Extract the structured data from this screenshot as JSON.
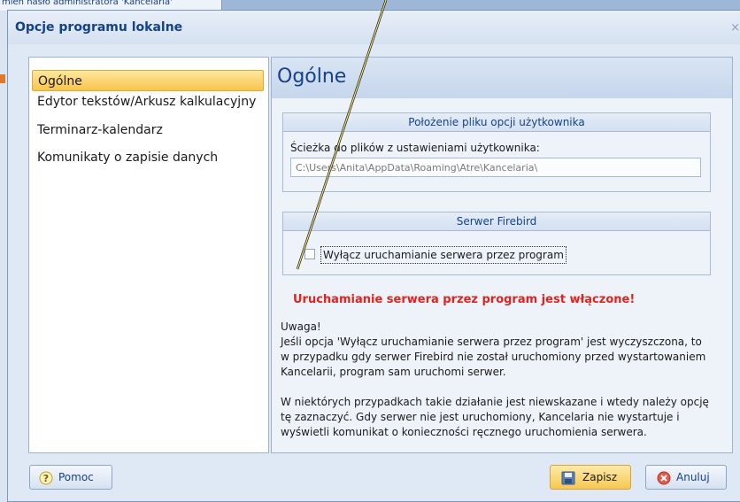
{
  "background": {
    "window_text": "mień hasło administratora 'Kancelaria'"
  },
  "dialog": {
    "title": "Opcje programu lokalne",
    "close_label": "×"
  },
  "nav": {
    "items": [
      {
        "label": "Ogólne",
        "active": true
      },
      {
        "label": "Edytor tekstów/Arkusz kalkulacyjny",
        "active": false
      },
      {
        "label": "Terminarz-kalendarz",
        "active": false
      },
      {
        "label": "Komunikaty o zapisie danych",
        "active": false
      }
    ]
  },
  "panel": {
    "title": "Ogólne",
    "user_options": {
      "header": "Położenie pliku opcji  użytkownika",
      "path_label": "Ścieżka do plików z ustawieniami użytkownika:",
      "path_value": "C:\\Users\\Anita\\AppData\\Roaming\\Atre\\Kancelaria\\"
    },
    "firebird": {
      "header": "Serwer Firebird",
      "checkbox_label": "Wyłącz uruchamianie serwera przez program",
      "checked": false
    },
    "warning": "Uruchamianie serwera przez program jest włączone!",
    "note": {
      "line1": "Uwaga!",
      "line2": "Jeśli opcja 'Wyłącz uruchamianie serwera przez program' jest wyczyszczona, to",
      "line3": "w przypadku gdy serwer Firebird nie został uruchomiony przed wystartowaniem",
      "line4": "Kancelarii, program sam uruchomi serwer.",
      "line5": "W niektórych przypadkach takie działanie jest niewskazane i wtedy należy opcję",
      "line6": "tę zaznaczyć. Gdy serwer nie jest uruchomiony, Kancelaria nie wystartuje i",
      "line7": "wyświetli komunikat o konieczności ręcznego uruchomienia serwera."
    }
  },
  "buttons": {
    "help": "Pomoc",
    "save": "Zapisz",
    "cancel": "Anuluj"
  },
  "colors": {
    "accent": "#15428b",
    "active_nav": "#f8c44c",
    "warning": "#e0231e"
  }
}
